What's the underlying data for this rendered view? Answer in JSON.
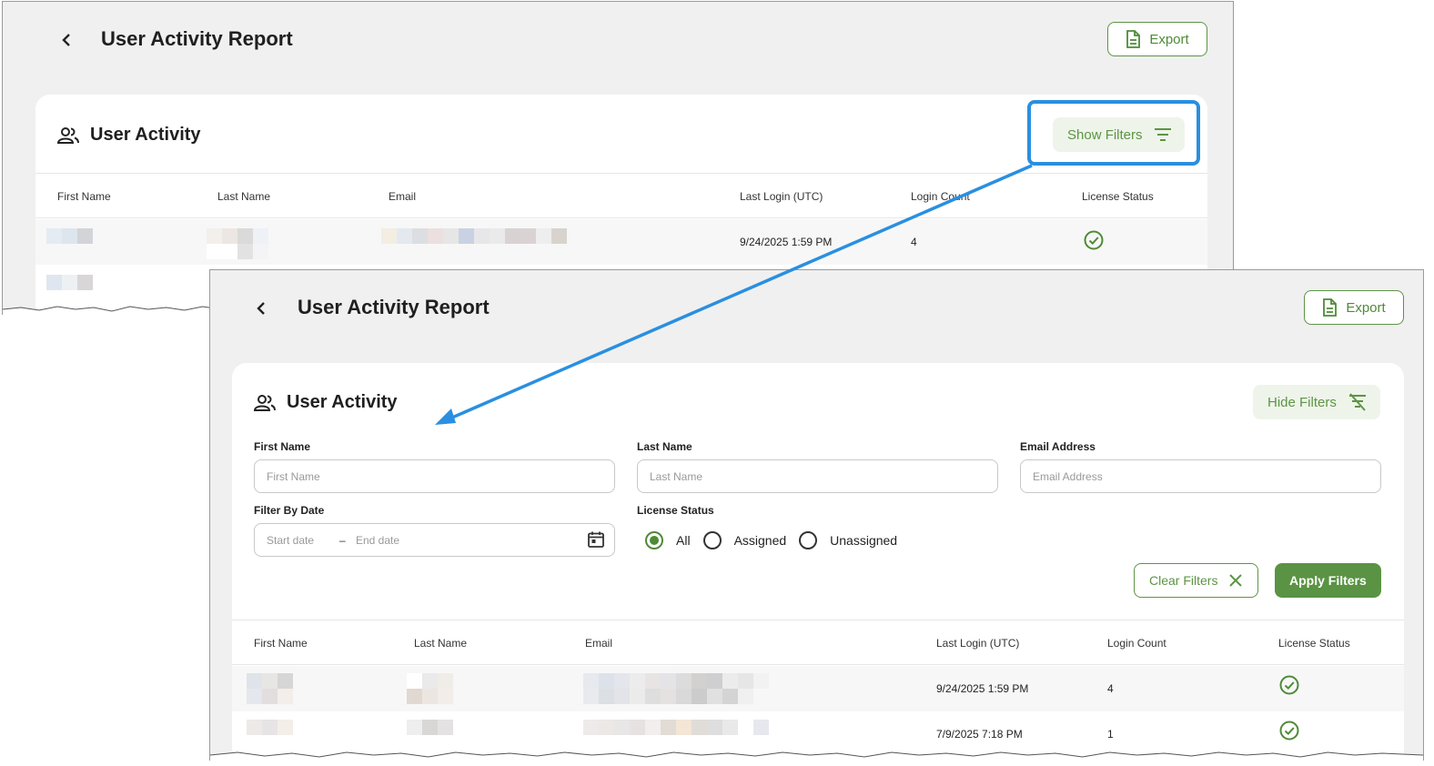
{
  "page": {
    "title": "User Activity Report",
    "export_label": "Export"
  },
  "card": {
    "title": "User Activity",
    "show_filters_label": "Show Filters",
    "hide_filters_label": "Hide Filters"
  },
  "filters": {
    "first_name": {
      "label": "First Name",
      "placeholder": "First Name"
    },
    "last_name": {
      "label": "Last Name",
      "placeholder": "Last Name"
    },
    "email": {
      "label": "Email Address",
      "placeholder": "Email Address"
    },
    "date": {
      "label": "Filter By Date",
      "start_placeholder": "Start date",
      "separator": "–",
      "end_placeholder": "End date"
    },
    "license": {
      "label": "License Status",
      "options": [
        "All",
        "Assigned",
        "Unassigned"
      ],
      "selected": "All"
    },
    "clear_label": "Clear Filters",
    "apply_label": "Apply Filters"
  },
  "table": {
    "columns": [
      "First Name",
      "Last Name",
      "Email",
      "Last Login (UTC)",
      "Login Count",
      "License Status"
    ],
    "rows": [
      {
        "last_login": "9/24/2025 1:59 PM",
        "login_count": "4",
        "license_status": "assigned"
      },
      {
        "last_login": "7/9/2025 7:18 PM",
        "login_count": "1",
        "license_status": "assigned"
      }
    ]
  },
  "colors": {
    "accent": "#5a9343",
    "accent_light": "#eef4ea",
    "callout": "#2a8fe0",
    "background": "#f0f0f0"
  },
  "icons": [
    "back-chevron-icon",
    "document-icon",
    "users-icon",
    "filter-icon",
    "filter-off-icon",
    "calendar-icon",
    "close-icon",
    "check-circle-icon"
  ]
}
